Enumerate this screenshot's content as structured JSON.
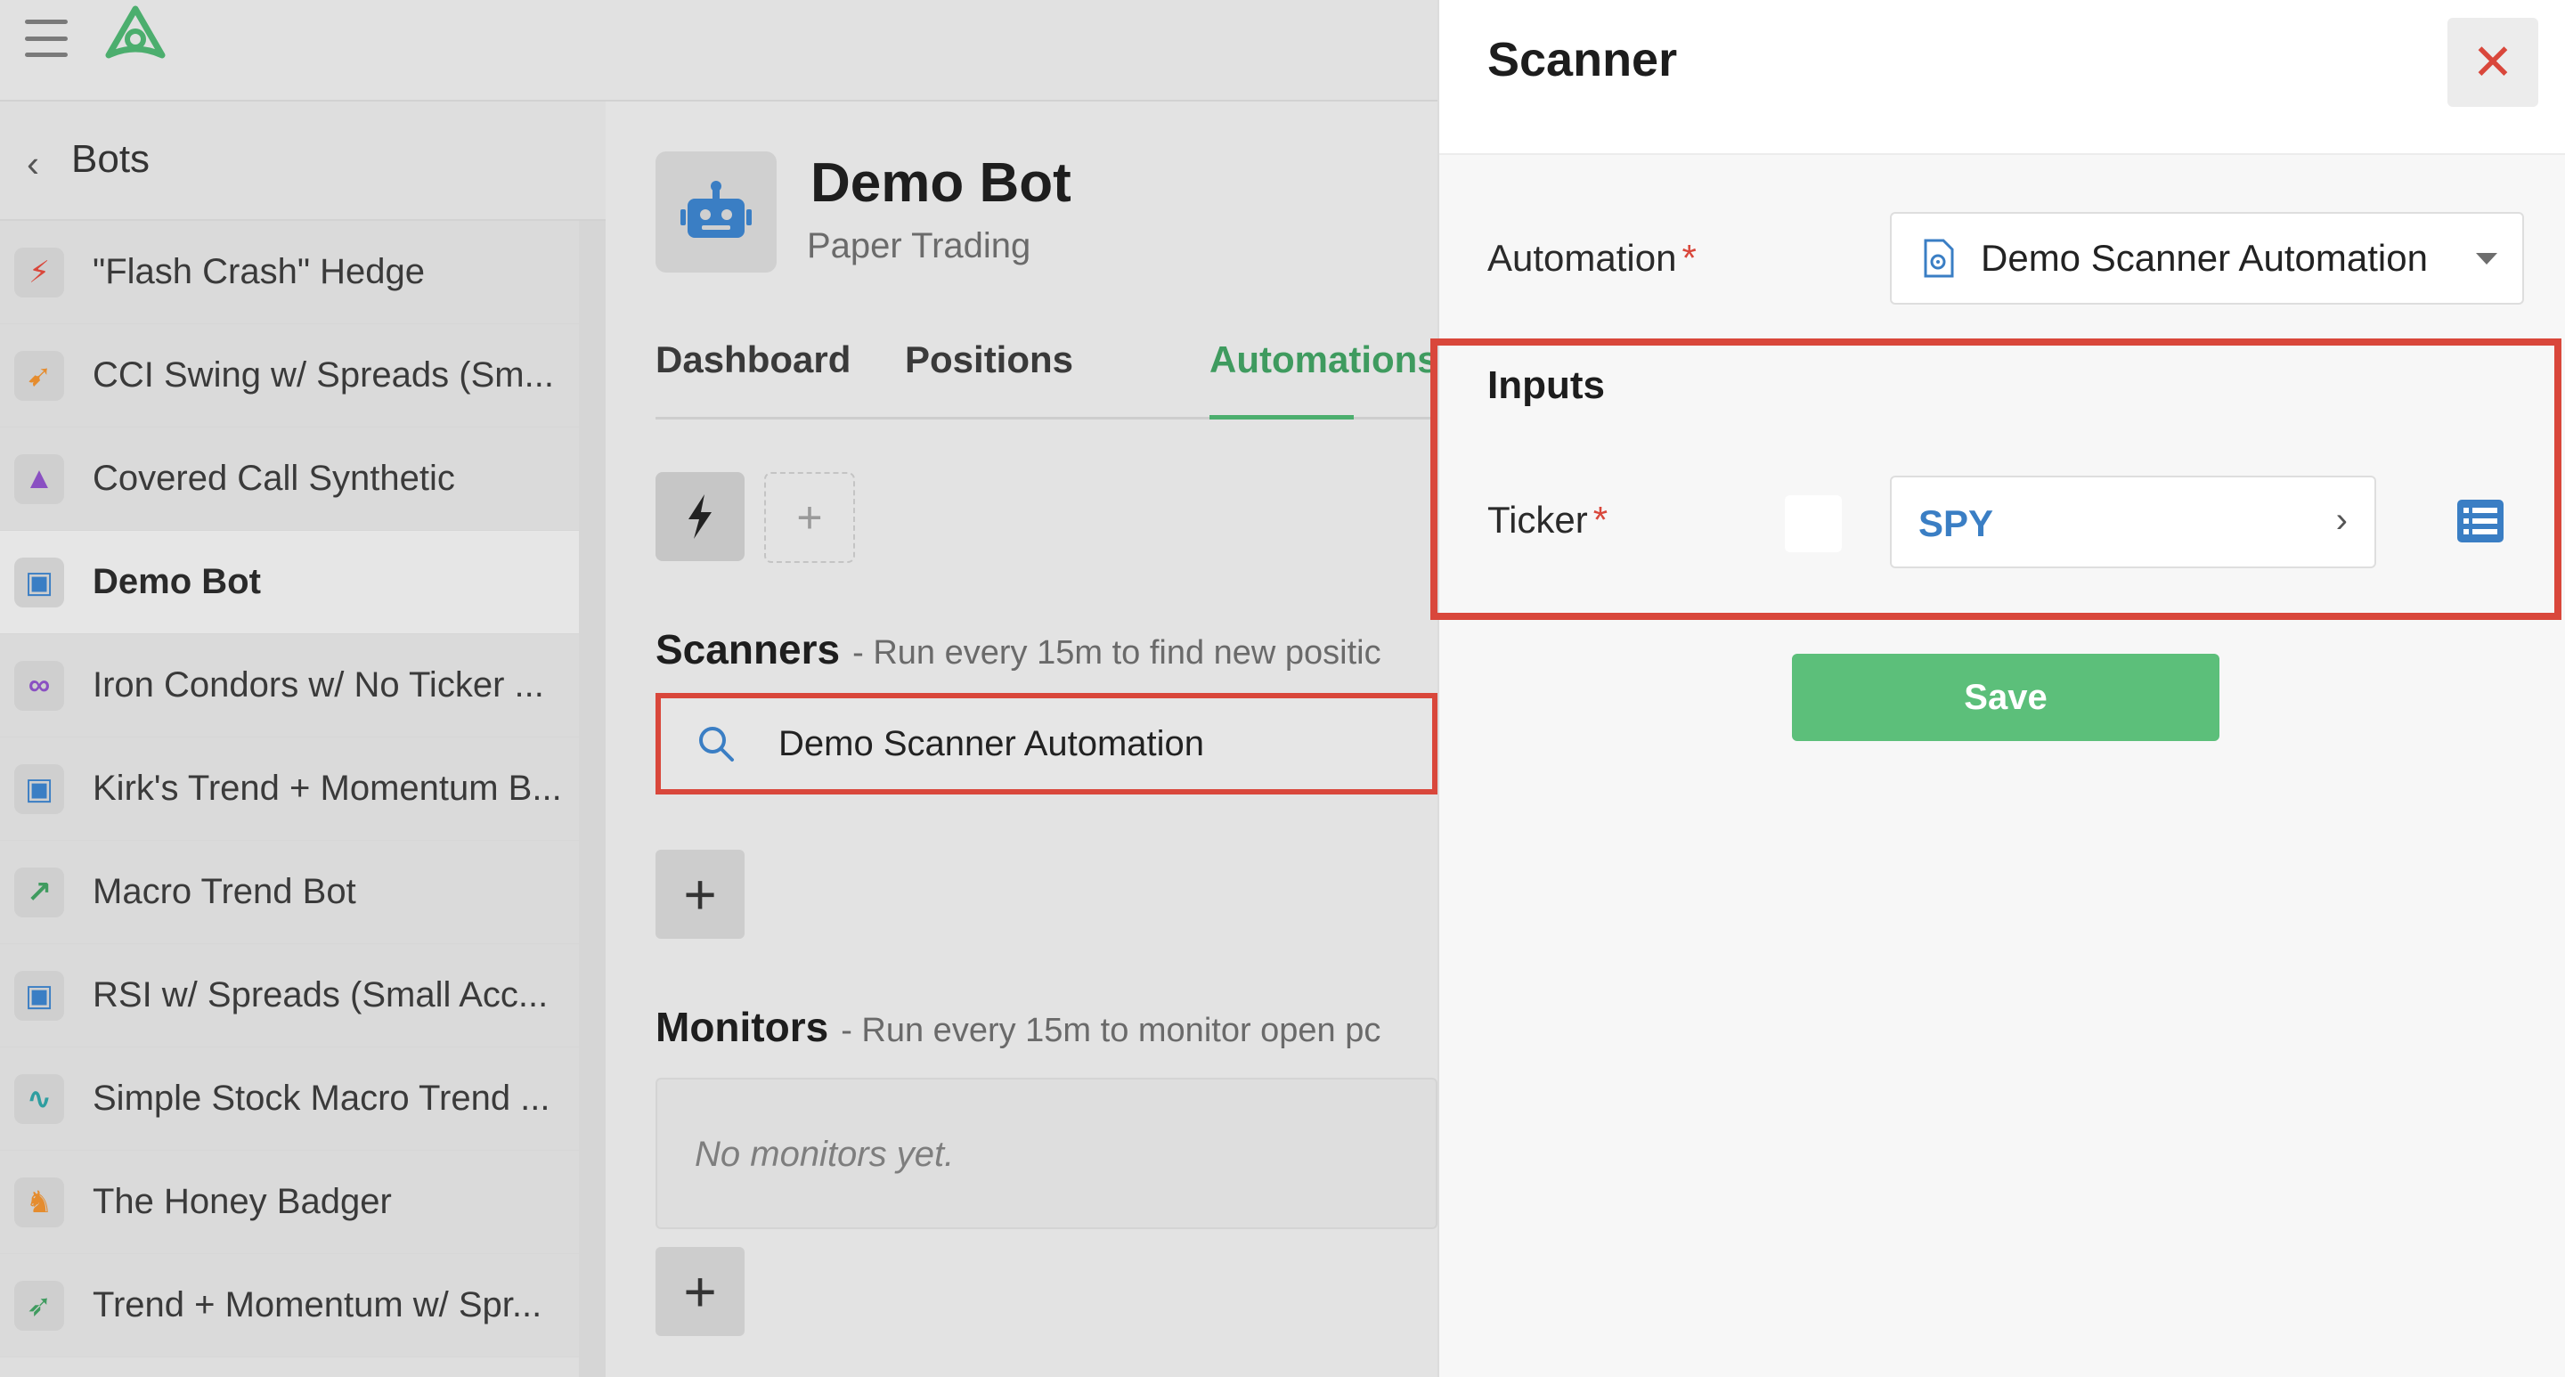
{
  "topbar": {
    "menu_icon": "hamburger-icon",
    "logo_icon": "logo-icon"
  },
  "sidebar": {
    "back_icon": "chevron-left-icon",
    "title": "Bots",
    "items": [
      {
        "label": "\"Flash Crash\" Hedge",
        "icon": "bolt-icon",
        "color": "#d9473b",
        "glyph": "⚡"
      },
      {
        "label": "CCI Swing w/ Spreads (Sm...",
        "icon": "gun-icon",
        "color": "#e58c2e",
        "glyph": "➹"
      },
      {
        "label": "Covered Call Synthetic",
        "icon": "wizard-hat-icon",
        "color": "#8a50c2",
        "glyph": "▲"
      },
      {
        "label": "Demo Bot",
        "icon": "robot-icon",
        "color": "#3a7ec4",
        "glyph": "▣",
        "active": true
      },
      {
        "label": "Iron Condors w/ No Ticker ...",
        "icon": "condor-icon",
        "color": "#8a50c2",
        "glyph": "∞"
      },
      {
        "label": "Kirk's Trend + Momentum B...",
        "icon": "robot-icon",
        "color": "#3a7ec4",
        "glyph": "▣"
      },
      {
        "label": "Macro Trend Bot",
        "icon": "chart-line-icon",
        "color": "#3f9b5f",
        "glyph": "↗"
      },
      {
        "label": "RSI w/ Spreads (Small Acc...",
        "icon": "robot-icon",
        "color": "#3a7ec4",
        "glyph": "▣"
      },
      {
        "label": "Simple Stock Macro Trend ...",
        "icon": "heartbeat-icon",
        "color": "#2f9ea0",
        "glyph": "∿"
      },
      {
        "label": "The Honey Badger",
        "icon": "badger-icon",
        "color": "#e58c2e",
        "glyph": "♞"
      },
      {
        "label": "Trend + Momentum w/ Spr...",
        "icon": "rocket-icon",
        "color": "#3f9b5f",
        "glyph": "➶"
      }
    ]
  },
  "main": {
    "bot_name": "Demo Bot",
    "bot_mode": "Paper Trading",
    "tabs": [
      {
        "label": "Dashboard"
      },
      {
        "label": "Positions"
      },
      {
        "label": "Automations",
        "active": true
      }
    ],
    "quick_action_icon": "bolt-icon",
    "quick_add": "+",
    "scanners": {
      "title": "Scanners",
      "subtitle": "- Run every 15m to find new positic",
      "items": [
        {
          "name": "Demo Scanner Automation"
        }
      ],
      "add_label": "+"
    },
    "monitors": {
      "title": "Monitors",
      "subtitle": "- Run every 15m to monitor open pc",
      "empty_text": "No monitors yet.",
      "add_label": "+"
    }
  },
  "panel": {
    "title": "Scanner",
    "close_label": "✕",
    "automation_label": "Automation",
    "required_mark": "*",
    "automation_value": "Demo Scanner Automation",
    "inputs_title": "Inputs",
    "ticker_label": "Ticker",
    "ticker_value": "SPY",
    "ticker_chevron": "›",
    "save_label": "Save"
  },
  "colors": {
    "accent_green": "#4cae6e",
    "save_green": "#5cbf7a",
    "highlight_red": "#d9473b",
    "link_blue": "#3a7ec4"
  }
}
